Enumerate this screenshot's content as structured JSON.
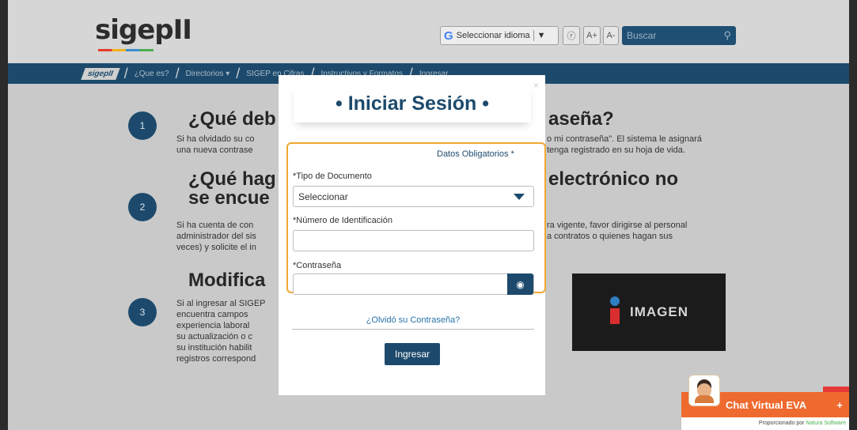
{
  "header": {
    "logo_text": "sigepII",
    "language_label": "Seleccionar idioma",
    "language_icon": "G",
    "rss_label": "ણ",
    "font_increase": "A+",
    "font_decrease": "A-",
    "search_placeholder": "Buscar"
  },
  "nav": {
    "home": "sigepII",
    "items": [
      "¿Que es?",
      "Directorios",
      "SIGEP en Cifras",
      "Instructivos y Formatos",
      "Ingresar"
    ]
  },
  "content": {
    "steps": [
      {
        "number": "1",
        "title": "¿Qué deb",
        "title_right": "aseña?",
        "text_left": "Si ha olvidado su co\nuna nueva contrase",
        "text_right": "o mi contraseña\". El sistema le asignará\ntenga registrado en su hoja de vida."
      },
      {
        "number": "2",
        "title": "¿Qué hag",
        "title2": "se encue",
        "title_right": "electrónico no",
        "text_left": "Si ha cuenta de con\nadministrador del sis\nveces) y solicite el in",
        "text_right": "ra vigente, favor dirigirse al personal\na contratos o quienes hagan sus"
      },
      {
        "number": "3",
        "title": "Modifica",
        "text_left": "Si al ingresar al SIGEP\nencuentra campos\nexperiencia laboral\nsu actualización o c\nsu institución habilit\nregistros correspond"
      }
    ],
    "image_label": "IMAGEN"
  },
  "modal": {
    "title": "• Iniciar Sesión •",
    "close": "×",
    "required_note": "Datos Obligatorios *",
    "doc_type_label": "*Tipo de Documento",
    "doc_type_value": "Seleccionar",
    "id_label": "*Número de Identificación",
    "id_value": "",
    "password_label": "*Contraseña",
    "password_value": "",
    "forgot_link": "¿Olvidó su Contraseña?",
    "submit": "Ingresar"
  },
  "chat": {
    "title": "Chat Virtual EVA",
    "plus": "+",
    "powered": "Proporcionado por",
    "vendor": "Natura Software"
  },
  "colors": {
    "primary": "#1d4a6c",
    "highlight": "#f0a830",
    "chat": "#ef6a2f"
  }
}
